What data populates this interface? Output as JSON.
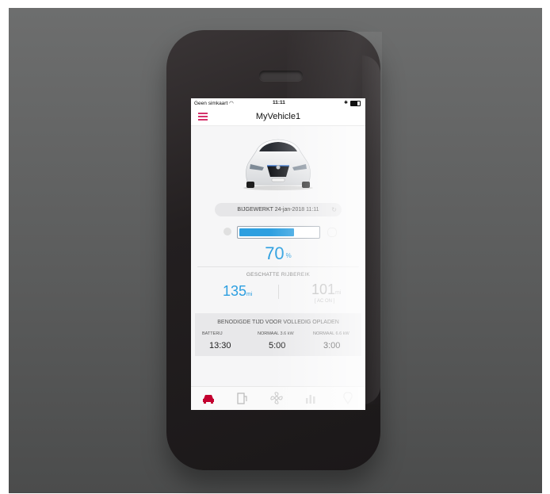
{
  "status": {
    "carrier": "Geen simkaart",
    "time": "11:11"
  },
  "nav": {
    "title": "MyVehicle1"
  },
  "update": {
    "label": "BIJGEWERKT",
    "timestamp": "24-jan-2018 11:11"
  },
  "battery": {
    "percent": 70,
    "unit": "%"
  },
  "range": {
    "label": "GESCHATTE RIJBEREIK",
    "primary_value": "135",
    "primary_unit": "mi",
    "secondary_value": "101",
    "secondary_unit": "mi",
    "secondary_note": "[ AC ON ]"
  },
  "charge": {
    "title": "BENODIGDE TIJD VOOR VOLLEDIG OPLADEN",
    "columns": [
      {
        "label": "BATTERIJ",
        "value": "13:30"
      },
      {
        "label": "NORMAAL  3.6 kW",
        "value": "5:00"
      },
      {
        "label": "NORMAAL  6.6 kW",
        "value": "3:00"
      }
    ]
  },
  "tabs": [
    {
      "name": "car-icon",
      "active": true
    },
    {
      "name": "charging-station-icon",
      "active": false
    },
    {
      "name": "fan-icon",
      "active": false
    },
    {
      "name": "stats-icon",
      "active": false
    },
    {
      "name": "map-pin-icon",
      "active": false
    }
  ],
  "colors": {
    "accent": "#2d9fe0",
    "brand": "#c3002f",
    "menu": "#d6336c"
  }
}
